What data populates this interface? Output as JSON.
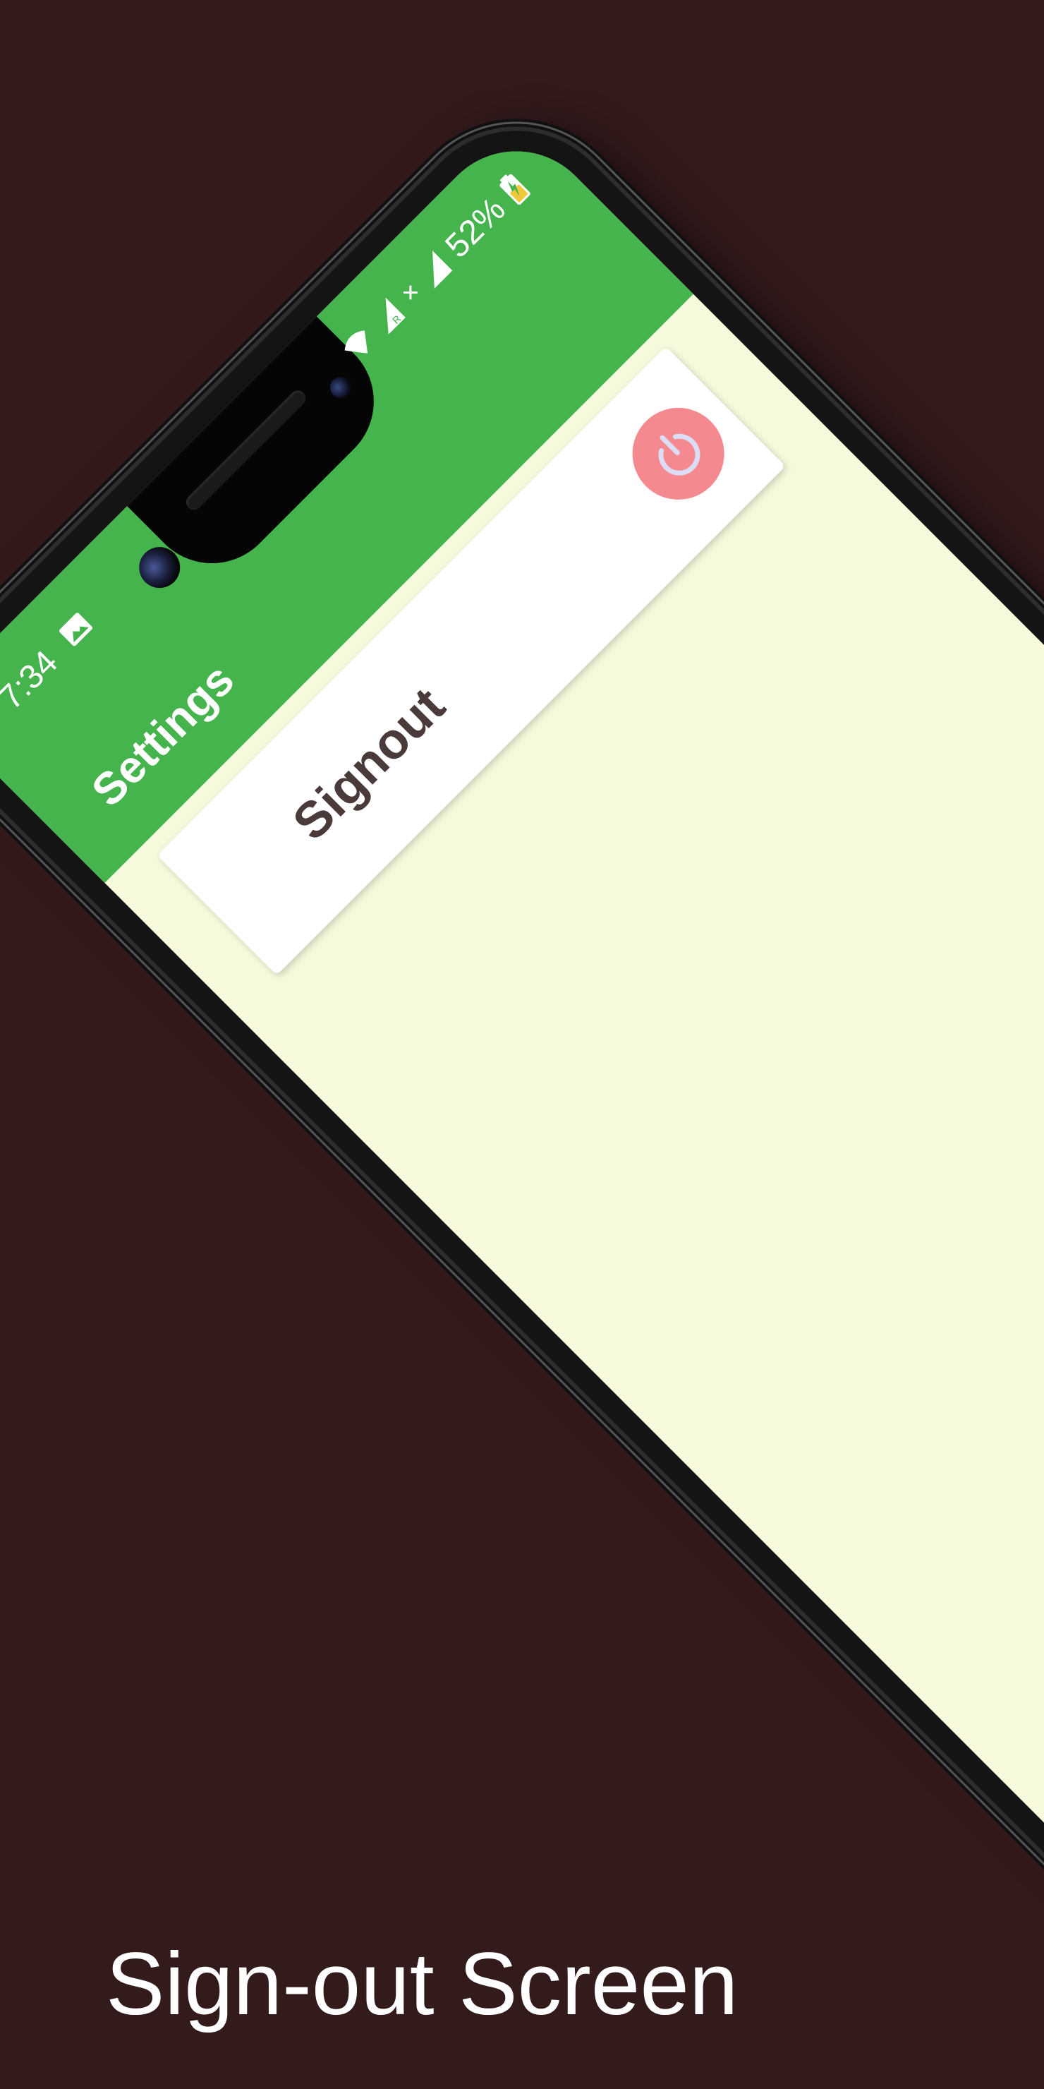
{
  "status_bar": {
    "time": "7:34",
    "battery": "52%",
    "icons": [
      "image-icon",
      "wifi-icon",
      "signal-icon",
      "signal-roaming-icon",
      "battery-charging-icon"
    ]
  },
  "app_bar": {
    "title": "Settings"
  },
  "settings": {
    "signout_label": "Signout",
    "signout_icon": "power-icon"
  },
  "caption": "Sign-out Screen",
  "colors": {
    "background": "#331a1b",
    "app_bar": "#46b44d",
    "screen_bg": "#f7f9dc",
    "card": "#ffffff",
    "power_button": "#f48a8f",
    "signout_text": "#4a3a3a"
  }
}
